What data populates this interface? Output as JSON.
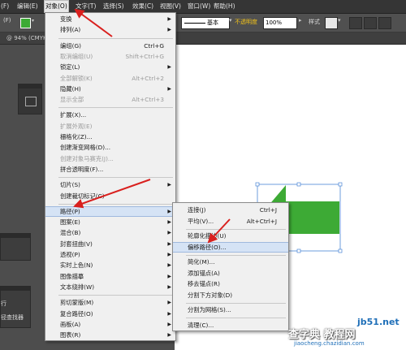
{
  "menubar": {
    "items": [
      {
        "label": "(F)",
        "active": false
      },
      {
        "label": "编辑(E)",
        "active": false
      },
      {
        "label": "对象(O)",
        "active": true
      },
      {
        "label": "文字(T)",
        "active": false
      },
      {
        "label": "选择(S)",
        "active": false
      },
      {
        "label": "效果(C)",
        "active": false
      },
      {
        "label": "视图(V)",
        "active": false
      },
      {
        "label": "窗口(W)",
        "active": false
      },
      {
        "label": "帮助(H)",
        "active": false
      }
    ]
  },
  "controlbar": {
    "stroke_style": "基本",
    "opacity_label": "不透明度",
    "opacity_value": "100%",
    "style_label": "样式"
  },
  "document_tab": "@ 94% (CMYK",
  "left_panel_text": {
    "line1": "行",
    "line2": "径查找器"
  },
  "object_menu": [
    {
      "label": "变换",
      "shortcut": "",
      "submenu": true,
      "disabled": false
    },
    {
      "label": "排列(A)",
      "shortcut": "",
      "submenu": true,
      "disabled": false
    },
    {
      "sep": true
    },
    {
      "label": "编组(G)",
      "shortcut": "Ctrl+G",
      "submenu": false,
      "disabled": false
    },
    {
      "label": "取消编组(U)",
      "shortcut": "Shift+Ctrl+G",
      "submenu": false,
      "disabled": true
    },
    {
      "label": "锁定(L)",
      "shortcut": "",
      "submenu": true,
      "disabled": false
    },
    {
      "label": "全部解锁(K)",
      "shortcut": "Alt+Ctrl+2",
      "submenu": false,
      "disabled": true
    },
    {
      "label": "隐藏(H)",
      "shortcut": "",
      "submenu": true,
      "disabled": false
    },
    {
      "label": "显示全部",
      "shortcut": "Alt+Ctrl+3",
      "submenu": false,
      "disabled": true
    },
    {
      "sep": true
    },
    {
      "label": "扩展(X)...",
      "shortcut": "",
      "submenu": false,
      "disabled": false
    },
    {
      "label": "扩展外观(E)",
      "shortcut": "",
      "submenu": false,
      "disabled": true
    },
    {
      "label": "栅格化(Z)...",
      "shortcut": "",
      "submenu": false,
      "disabled": false
    },
    {
      "label": "创建渐变网格(D)...",
      "shortcut": "",
      "submenu": false,
      "disabled": false
    },
    {
      "label": "创建对象马赛克(J)...",
      "shortcut": "",
      "submenu": false,
      "disabled": true
    },
    {
      "label": "拼合透明度(F)...",
      "shortcut": "",
      "submenu": false,
      "disabled": false
    },
    {
      "sep": true
    },
    {
      "label": "切片(S)",
      "shortcut": "",
      "submenu": true,
      "disabled": false
    },
    {
      "label": "创建裁切标记(C)",
      "shortcut": "",
      "submenu": false,
      "disabled": false
    },
    {
      "sep": true
    },
    {
      "label": "路径(P)",
      "shortcut": "",
      "submenu": true,
      "disabled": false,
      "highlight": true
    },
    {
      "label": "图案(E)",
      "shortcut": "",
      "submenu": true,
      "disabled": false
    },
    {
      "label": "混合(B)",
      "shortcut": "",
      "submenu": true,
      "disabled": false
    },
    {
      "label": "封套扭曲(V)",
      "shortcut": "",
      "submenu": true,
      "disabled": false
    },
    {
      "label": "透视(P)",
      "shortcut": "",
      "submenu": true,
      "disabled": false
    },
    {
      "label": "实时上色(N)",
      "shortcut": "",
      "submenu": true,
      "disabled": false
    },
    {
      "label": "图像描摹",
      "shortcut": "",
      "submenu": true,
      "disabled": false
    },
    {
      "label": "文本绕排(W)",
      "shortcut": "",
      "submenu": true,
      "disabled": false
    },
    {
      "sep": true
    },
    {
      "label": "剪切蒙版(M)",
      "shortcut": "",
      "submenu": true,
      "disabled": false
    },
    {
      "label": "复合路径(O)",
      "shortcut": "",
      "submenu": true,
      "disabled": false
    },
    {
      "label": "画板(A)",
      "shortcut": "",
      "submenu": true,
      "disabled": false
    },
    {
      "label": "图表(R)",
      "shortcut": "",
      "submenu": true,
      "disabled": false
    }
  ],
  "path_submenu": [
    {
      "label": "连接(J)",
      "shortcut": "Ctrl+J",
      "disabled": false
    },
    {
      "label": "平均(V)...",
      "shortcut": "Alt+Ctrl+J",
      "disabled": false
    },
    {
      "sep": true
    },
    {
      "label": "轮廓化描边(U)",
      "shortcut": "",
      "disabled": false
    },
    {
      "label": "偏移路径(O)...",
      "shortcut": "",
      "disabled": false,
      "highlight": true
    },
    {
      "sep": true
    },
    {
      "label": "简化(M)...",
      "shortcut": "",
      "disabled": false
    },
    {
      "label": "添加锚点(A)",
      "shortcut": "",
      "disabled": false
    },
    {
      "label": "移去锚点(R)",
      "shortcut": "",
      "disabled": false
    },
    {
      "label": "分割下方对象(D)",
      "shortcut": "",
      "disabled": false
    },
    {
      "sep": true
    },
    {
      "label": "分割为网格(S)...",
      "shortcut": "",
      "disabled": false
    },
    {
      "sep": true
    },
    {
      "label": "清理(C)...",
      "shortcut": "",
      "disabled": false
    }
  ],
  "colors": {
    "fill": "#3daa35",
    "arrow_annotation": "#d9201e",
    "selection": "#4a86d6",
    "menu_highlight": "#d5e3f5"
  },
  "watermark": {
    "line1": "jb51.net",
    "line2": "查字典 教程网",
    "line3": "jiaocheng.chazidian.com"
  }
}
